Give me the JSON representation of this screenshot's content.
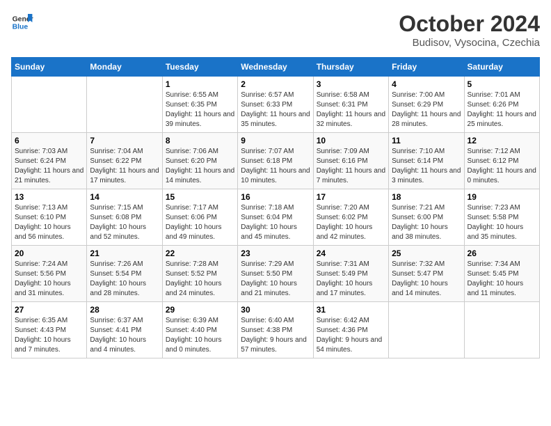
{
  "logo": {
    "line1": "General",
    "line2": "Blue"
  },
  "title": "October 2024",
  "subtitle": "Budisov, Vysocina, Czechia",
  "days_of_week": [
    "Sunday",
    "Monday",
    "Tuesday",
    "Wednesday",
    "Thursday",
    "Friday",
    "Saturday"
  ],
  "weeks": [
    [
      {
        "day": "",
        "info": ""
      },
      {
        "day": "",
        "info": ""
      },
      {
        "day": "1",
        "info": "Sunrise: 6:55 AM\nSunset: 6:35 PM\nDaylight: 11 hours and 39 minutes."
      },
      {
        "day": "2",
        "info": "Sunrise: 6:57 AM\nSunset: 6:33 PM\nDaylight: 11 hours and 35 minutes."
      },
      {
        "day": "3",
        "info": "Sunrise: 6:58 AM\nSunset: 6:31 PM\nDaylight: 11 hours and 32 minutes."
      },
      {
        "day": "4",
        "info": "Sunrise: 7:00 AM\nSunset: 6:29 PM\nDaylight: 11 hours and 28 minutes."
      },
      {
        "day": "5",
        "info": "Sunrise: 7:01 AM\nSunset: 6:26 PM\nDaylight: 11 hours and 25 minutes."
      }
    ],
    [
      {
        "day": "6",
        "info": "Sunrise: 7:03 AM\nSunset: 6:24 PM\nDaylight: 11 hours and 21 minutes."
      },
      {
        "day": "7",
        "info": "Sunrise: 7:04 AM\nSunset: 6:22 PM\nDaylight: 11 hours and 17 minutes."
      },
      {
        "day": "8",
        "info": "Sunrise: 7:06 AM\nSunset: 6:20 PM\nDaylight: 11 hours and 14 minutes."
      },
      {
        "day": "9",
        "info": "Sunrise: 7:07 AM\nSunset: 6:18 PM\nDaylight: 11 hours and 10 minutes."
      },
      {
        "day": "10",
        "info": "Sunrise: 7:09 AM\nSunset: 6:16 PM\nDaylight: 11 hours and 7 minutes."
      },
      {
        "day": "11",
        "info": "Sunrise: 7:10 AM\nSunset: 6:14 PM\nDaylight: 11 hours and 3 minutes."
      },
      {
        "day": "12",
        "info": "Sunrise: 7:12 AM\nSunset: 6:12 PM\nDaylight: 11 hours and 0 minutes."
      }
    ],
    [
      {
        "day": "13",
        "info": "Sunrise: 7:13 AM\nSunset: 6:10 PM\nDaylight: 10 hours and 56 minutes."
      },
      {
        "day": "14",
        "info": "Sunrise: 7:15 AM\nSunset: 6:08 PM\nDaylight: 10 hours and 52 minutes."
      },
      {
        "day": "15",
        "info": "Sunrise: 7:17 AM\nSunset: 6:06 PM\nDaylight: 10 hours and 49 minutes."
      },
      {
        "day": "16",
        "info": "Sunrise: 7:18 AM\nSunset: 6:04 PM\nDaylight: 10 hours and 45 minutes."
      },
      {
        "day": "17",
        "info": "Sunrise: 7:20 AM\nSunset: 6:02 PM\nDaylight: 10 hours and 42 minutes."
      },
      {
        "day": "18",
        "info": "Sunrise: 7:21 AM\nSunset: 6:00 PM\nDaylight: 10 hours and 38 minutes."
      },
      {
        "day": "19",
        "info": "Sunrise: 7:23 AM\nSunset: 5:58 PM\nDaylight: 10 hours and 35 minutes."
      }
    ],
    [
      {
        "day": "20",
        "info": "Sunrise: 7:24 AM\nSunset: 5:56 PM\nDaylight: 10 hours and 31 minutes."
      },
      {
        "day": "21",
        "info": "Sunrise: 7:26 AM\nSunset: 5:54 PM\nDaylight: 10 hours and 28 minutes."
      },
      {
        "day": "22",
        "info": "Sunrise: 7:28 AM\nSunset: 5:52 PM\nDaylight: 10 hours and 24 minutes."
      },
      {
        "day": "23",
        "info": "Sunrise: 7:29 AM\nSunset: 5:50 PM\nDaylight: 10 hours and 21 minutes."
      },
      {
        "day": "24",
        "info": "Sunrise: 7:31 AM\nSunset: 5:49 PM\nDaylight: 10 hours and 17 minutes."
      },
      {
        "day": "25",
        "info": "Sunrise: 7:32 AM\nSunset: 5:47 PM\nDaylight: 10 hours and 14 minutes."
      },
      {
        "day": "26",
        "info": "Sunrise: 7:34 AM\nSunset: 5:45 PM\nDaylight: 10 hours and 11 minutes."
      }
    ],
    [
      {
        "day": "27",
        "info": "Sunrise: 6:35 AM\nSunset: 4:43 PM\nDaylight: 10 hours and 7 minutes."
      },
      {
        "day": "28",
        "info": "Sunrise: 6:37 AM\nSunset: 4:41 PM\nDaylight: 10 hours and 4 minutes."
      },
      {
        "day": "29",
        "info": "Sunrise: 6:39 AM\nSunset: 4:40 PM\nDaylight: 10 hours and 0 minutes."
      },
      {
        "day": "30",
        "info": "Sunrise: 6:40 AM\nSunset: 4:38 PM\nDaylight: 9 hours and 57 minutes."
      },
      {
        "day": "31",
        "info": "Sunrise: 6:42 AM\nSunset: 4:36 PM\nDaylight: 9 hours and 54 minutes."
      },
      {
        "day": "",
        "info": ""
      },
      {
        "day": "",
        "info": ""
      }
    ]
  ]
}
